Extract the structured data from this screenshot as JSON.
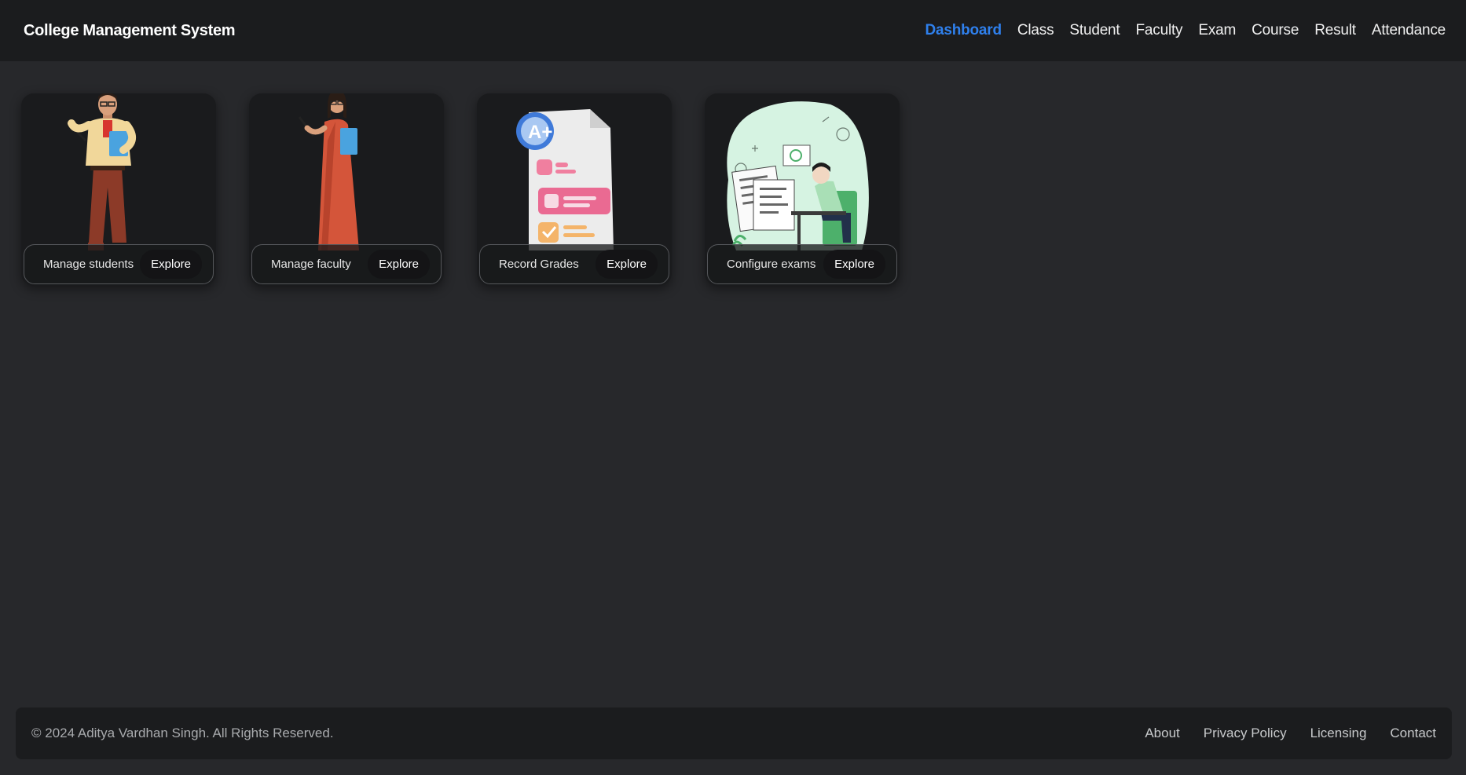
{
  "header": {
    "title": "College Management System",
    "nav": [
      {
        "label": "Dashboard",
        "active": true
      },
      {
        "label": "Class"
      },
      {
        "label": "Student"
      },
      {
        "label": "Faculty"
      },
      {
        "label": "Exam"
      },
      {
        "label": "Course"
      },
      {
        "label": "Result"
      },
      {
        "label": "Attendance"
      }
    ],
    "active_color": "#2f80ed"
  },
  "cards": [
    {
      "label": "Manage students",
      "button": "Explore",
      "image": "male-teacher-illustration"
    },
    {
      "label": "Manage faculty",
      "button": "Explore",
      "image": "female-teacher-illustration"
    },
    {
      "label": "Record Grades",
      "button": "Explore",
      "image": "grade-report-illustration",
      "badge": "A+"
    },
    {
      "label": "Configure exams",
      "button": "Explore",
      "image": "student-exam-illustration"
    }
  ],
  "footer": {
    "copyright": "© 2024 Aditya Vardhan Singh. All Rights Reserved.",
    "links": [
      "About",
      "Privacy Policy",
      "Licensing",
      "Contact"
    ]
  }
}
